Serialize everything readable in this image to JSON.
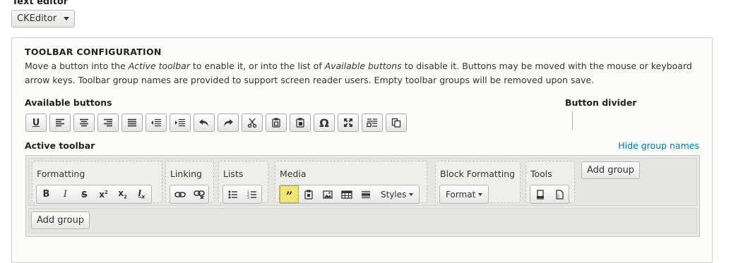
{
  "editor": {
    "label": "Text editor",
    "selected": "CKEditor"
  },
  "panel": {
    "title": "TOOLBAR CONFIGURATION",
    "desc_1": "Move a button into the ",
    "desc_em1": "Active toolbar",
    "desc_2": " to enable it, or into the list of ",
    "desc_em2": "Available buttons",
    "desc_3": " to disable it. Buttons may be moved with the mouse or keyboard arrow keys. Toolbar group names are provided to support screen reader users. Empty toolbar groups will be removed upon save."
  },
  "available": {
    "label": "Available buttons",
    "buttons": [
      {
        "icon": "underline-icon",
        "glyph": "U"
      },
      {
        "icon": "align-left-icon"
      },
      {
        "icon": "align-center-icon"
      },
      {
        "icon": "align-right-icon"
      },
      {
        "icon": "justify-icon"
      },
      {
        "icon": "outdent-icon"
      },
      {
        "icon": "indent-icon"
      },
      {
        "icon": "undo-icon"
      },
      {
        "icon": "redo-icon"
      },
      {
        "icon": "cut-icon"
      },
      {
        "icon": "copy-icon"
      },
      {
        "icon": "paste-icon"
      },
      {
        "icon": "special-char-icon",
        "glyph": "Ω"
      },
      {
        "icon": "maximize-icon"
      },
      {
        "icon": "show-blocks-icon"
      },
      {
        "icon": "paste-text-icon"
      }
    ]
  },
  "divider": {
    "label": "Button divider"
  },
  "active": {
    "label": "Active toolbar",
    "hide_link": "Hide group names",
    "groups": {
      "formatting": "Formatting",
      "linking": "Linking",
      "lists": "Lists",
      "media": "Media",
      "block": "Block Formatting",
      "tools": "Tools"
    },
    "styles_label": "Styles",
    "format_label": "Format",
    "add_group": "Add group",
    "add_group_2": "Add group"
  }
}
